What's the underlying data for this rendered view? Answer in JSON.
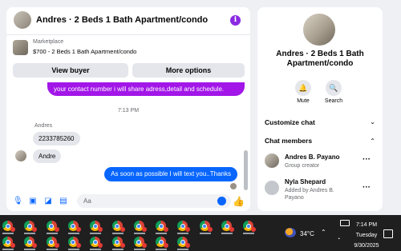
{
  "header": {
    "title": "Andres · 2 Beds 1 Bath Apartment/condo",
    "info_icon": "i"
  },
  "marketplace": {
    "label": "Marketplace",
    "listing": "$700 - 2 Beds 1 Bath Apartment/condo"
  },
  "actions": {
    "view_buyer": "View buyer",
    "more_options": "More options"
  },
  "messages": {
    "outgoing_top": "your contact number i will share adress,detail and schedule.",
    "timestamp": "7:13 PM",
    "sender_name": "Andres",
    "incoming": [
      "2233785260",
      "Andre"
    ],
    "outgoing_bottom": "As soon as possible I will text you..Thanks"
  },
  "composer": {
    "placeholder": "Aa"
  },
  "panel": {
    "title": "Andres · 2 Beds 1 Bath Apartment/condo",
    "mute_label": "Mute",
    "search_label": "Search",
    "customize_chat": "Customize chat",
    "chat_members": "Chat members",
    "members": [
      {
        "name": "Andres B. Payano",
        "sub": "Group creator"
      },
      {
        "name": "Nyla Shepard",
        "sub": "Added by Andres B. Payano"
      }
    ]
  },
  "taskbar": {
    "temperature": "34°C",
    "time": "7:14 PM",
    "day": "Tuesday",
    "date": "9/30/2025",
    "app_count": 21
  },
  "colors": {
    "accent_blue": "#0866ff",
    "purple_bubble": "#a216e8",
    "taskbar": "#1f1f1f"
  }
}
